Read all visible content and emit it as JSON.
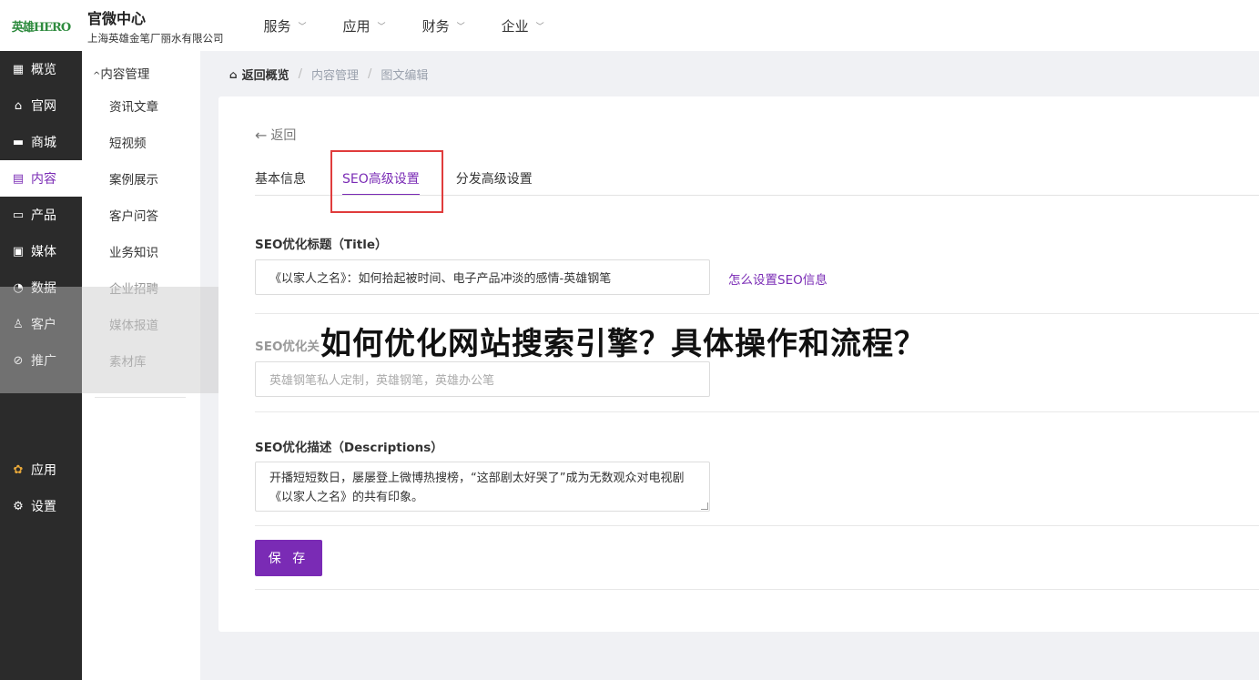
{
  "header": {
    "logo_text": "英雄HERO",
    "title": "官微中心",
    "subtitle": "上海英雄金笔厂丽水有限公司",
    "nav": [
      {
        "label": "服务"
      },
      {
        "label": "应用"
      },
      {
        "label": "财务"
      },
      {
        "label": "企业"
      }
    ]
  },
  "sidebar": {
    "items": [
      {
        "label": "概览",
        "icon": "dashboard-icon"
      },
      {
        "label": "官网",
        "icon": "home-icon"
      },
      {
        "label": "商城",
        "icon": "shop-icon"
      },
      {
        "label": "内容",
        "icon": "document-icon"
      },
      {
        "label": "产品",
        "icon": "box-icon"
      },
      {
        "label": "媒体",
        "icon": "video-icon"
      },
      {
        "label": "数据",
        "icon": "chart-icon"
      },
      {
        "label": "客户",
        "icon": "user-icon"
      },
      {
        "label": "推广",
        "icon": "link-icon"
      }
    ],
    "bottom": [
      {
        "label": "应用",
        "icon": "apps-icon"
      },
      {
        "label": "设置",
        "icon": "gear-icon"
      }
    ]
  },
  "subsidebar": {
    "heading": "内容管理",
    "items": [
      {
        "label": "资讯文章"
      },
      {
        "label": "短视频"
      },
      {
        "label": "案例展示"
      },
      {
        "label": "客户问答"
      },
      {
        "label": "业务知识"
      },
      {
        "label": "企业招聘"
      },
      {
        "label": "媒体报道"
      },
      {
        "label": "素材库"
      }
    ]
  },
  "breadcrumb": {
    "home": "返回概览",
    "items": [
      "内容管理",
      "图文编辑"
    ]
  },
  "form": {
    "back_label": "返回",
    "tabs": [
      {
        "label": "基本信息"
      },
      {
        "label": "SEO高级设置"
      },
      {
        "label": "分发高级设置"
      }
    ],
    "title_label": "SEO优化标题（Title）",
    "title_value": "《以家人之名》：如何拾起被时间、电子产品冲淡的感情-英雄钢笔",
    "help_link": "怎么设置SEO信息",
    "keywords_label": "SEO优化关",
    "keywords_placeholder": "英雄钢笔私人定制，英雄钢笔，英雄办公笔",
    "desc_label": "SEO优化描述（Descriptions）",
    "desc_value": "开播短短数日，屡屡登上微博热搜榜，“这部剧太好哭了”成为无数观众对电视剧《以家人之名》的共有印象。",
    "save_label": "保 存"
  },
  "overlay_headline": "如何优化网站搜索引擎？具体操作和流程？",
  "colors": {
    "accent": "#7a2bb5",
    "sidebar_bg": "#2b2b2b",
    "highlight": "#e03c3c"
  }
}
